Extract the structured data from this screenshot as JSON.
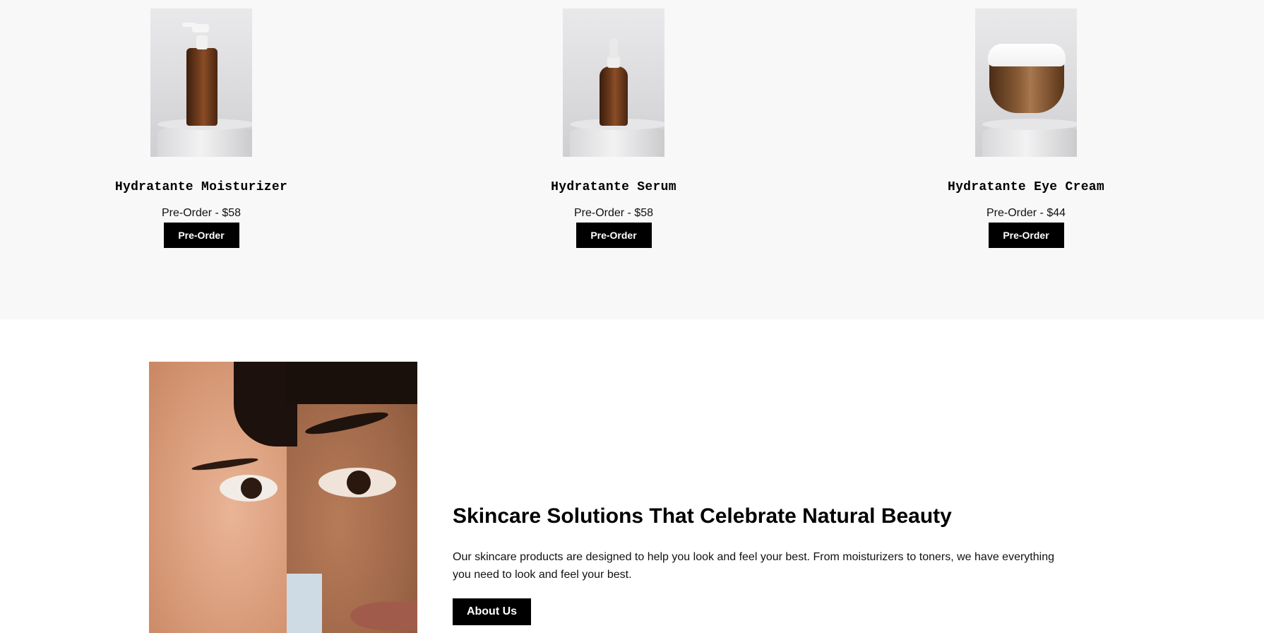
{
  "products": [
    {
      "name": "Hydratante Moisturizer",
      "price": "Pre-Order - $58",
      "button": "Pre-Order"
    },
    {
      "name": "Hydratante Serum",
      "price": "Pre-Order - $58",
      "button": "Pre-Order"
    },
    {
      "name": "Hydratante Eye Cream",
      "price": "Pre-Order - $44",
      "button": "Pre-Order"
    }
  ],
  "about": {
    "title": "Skincare Solutions That Celebrate Natural Beauty",
    "text": "Our skincare products are designed to help you look and feel your best. From moisturizers to toners, we have everything you need to look and feel your best.",
    "button": "About Us"
  },
  "colors": {
    "products_bg": "#f8f8f8",
    "button_bg": "#000000",
    "button_text": "#ffffff"
  }
}
